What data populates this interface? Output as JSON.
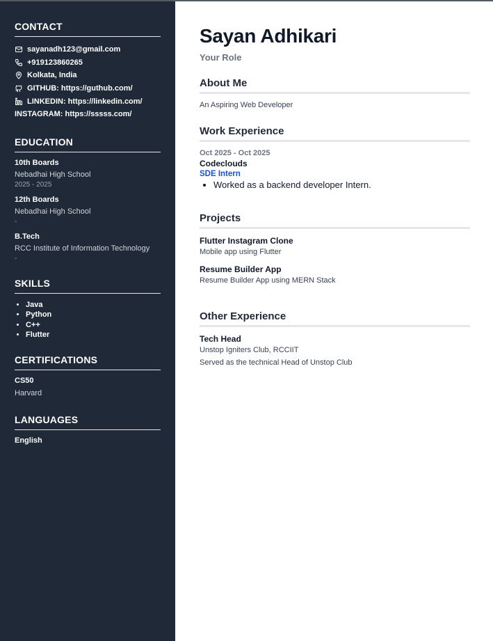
{
  "header": {
    "name": "Sayan Adhikari",
    "role": "Your Role"
  },
  "sidebar": {
    "contact": {
      "heading": "CONTACT",
      "email": "sayanadh123@gmail.com",
      "phone": "+919123860265",
      "location": "Kolkata, India",
      "github": "GITHUB: https://guthub.com/",
      "linkedin": "LINKEDIN: https://linkedin.com/",
      "instagram": "INSTAGRAM: https://sssss.com/"
    },
    "education": {
      "heading": "EDUCATION",
      "items": [
        {
          "title": "10th Boards",
          "school": "Nebadhai High School",
          "years": "2025 - 2025"
        },
        {
          "title": "12th Boards",
          "school": "Nebadhai High School",
          "years": "-"
        },
        {
          "title": "B.Tech",
          "school": "RCC Institute of Information Technology",
          "years": "-"
        }
      ]
    },
    "skills": {
      "heading": "SKILLS",
      "items": [
        "Java",
        "Python",
        "C++",
        "Flutter"
      ]
    },
    "certifications": {
      "heading": "CERTIFICATIONS",
      "title": "CS50",
      "issuer": "Harvard"
    },
    "languages": {
      "heading": "LANGUAGES",
      "items": [
        "English"
      ]
    }
  },
  "main": {
    "about": {
      "heading": "About Me",
      "text": "An Aspiring Web Developer"
    },
    "work": {
      "heading": "Work Experience",
      "date": "Oct 2025 - Oct 2025",
      "company": "Codeclouds",
      "position": "SDE Intern",
      "bullets": [
        "Worked as a backend developer Intern."
      ]
    },
    "projects": {
      "heading": "Projects",
      "items": [
        {
          "title": "Flutter Instagram Clone",
          "desc": "Mobile app using Flutter"
        },
        {
          "title": "Resume Builder App",
          "desc": "Resume Builder App using MERN Stack"
        }
      ]
    },
    "other": {
      "heading": "Other Experience",
      "title": "Tech Head",
      "org": "Unstop Igniters Club, RCCIIT",
      "desc": "Served as the technical Head of Unstop Club"
    }
  },
  "colors": {
    "sidebar_bg": "#1f2937",
    "accent_blue": "#1d4ed8"
  }
}
